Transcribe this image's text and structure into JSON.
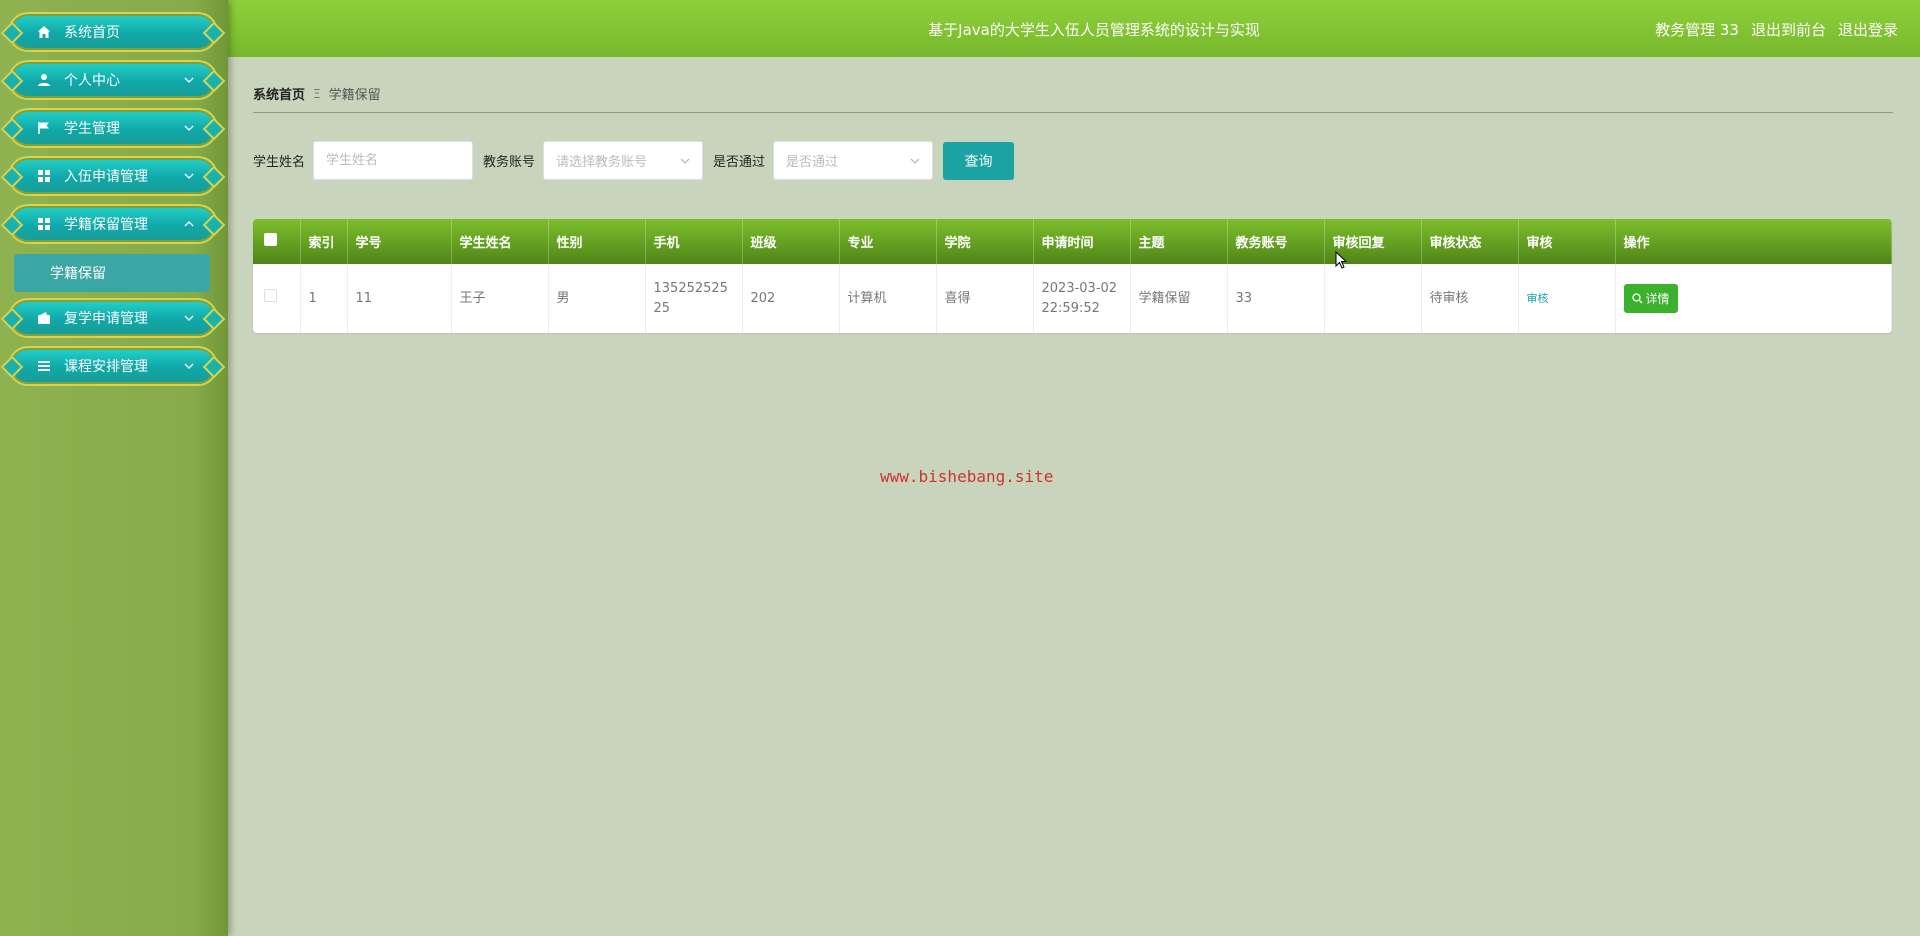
{
  "sidebar": {
    "items": [
      {
        "label": "系统首页",
        "icon": "home-icon"
      },
      {
        "label": "个人中心",
        "icon": "user-icon"
      },
      {
        "label": "学生管理",
        "icon": "flag-icon"
      },
      {
        "label": "入伍申请管理",
        "icon": "grid-icon"
      },
      {
        "label": "学籍保留管理",
        "icon": "grid-icon"
      },
      {
        "label": "复学申请管理",
        "icon": "wallet-icon"
      },
      {
        "label": "课程安排管理",
        "icon": "list-icon"
      }
    ],
    "sub_item": "学籍保留"
  },
  "header": {
    "title": "基于Java的大学生入伍人员管理系统的设计与实现",
    "user": "教务管理 33",
    "to_front": "退出到前台",
    "logout": "退出登录"
  },
  "breadcrumb": {
    "home": "系统首页",
    "separator": "Ξ",
    "current": "学籍保留"
  },
  "filters": {
    "name_label": "学生姓名",
    "name_placeholder": "学生姓名",
    "account_label": "教务账号",
    "account_placeholder": "请选择教务账号",
    "pass_label": "是否通过",
    "pass_placeholder": "是否通过",
    "query_button": "查询"
  },
  "table": {
    "headers": [
      "索引",
      "学号",
      "学生姓名",
      "性别",
      "手机",
      "班级",
      "专业",
      "学院",
      "申请时间",
      "主题",
      "教务账号",
      "审核回复",
      "审核状态",
      "审核",
      "操作"
    ],
    "rows": [
      {
        "index": "1",
        "student_no": "11",
        "name": "王子",
        "gender": "男",
        "phone_line1": "135252525",
        "phone_line2": "25",
        "class": "202",
        "major": "计算机",
        "college": "喜得",
        "date": "2023-03-02",
        "time": "22:59:52",
        "topic": "学籍保留",
        "account": "33",
        "reply": "",
        "status": "待审核",
        "audit": "审核",
        "detail": "详情"
      }
    ]
  },
  "watermark": "www.bishebang.site",
  "colors": {
    "sidebar": "#8fb251",
    "topbar": "#82c434",
    "accent": "#1ba3a3",
    "table_header": "#6aa524",
    "detail_button": "#3bb12d"
  }
}
